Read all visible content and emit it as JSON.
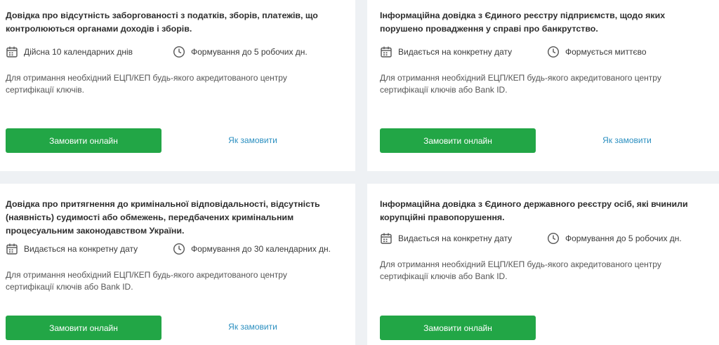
{
  "cards": [
    {
      "title": "Довідка про відсутність заборгованості з податків, зборів, платежів, що контролюються органами доходів і зборів.",
      "meta1": "Дійсна 10 календарних днів",
      "meta2": "Формування до 5 робочих дн.",
      "description": "Для отримання необхідний ЕЦП/КЕП будь-якого акредитованого центру сертифікації ключів.",
      "button": "Замовити онлайн",
      "link": "Як замовити"
    },
    {
      "title": "Інформаційна довідка з Єдиного реєстру підприємств, щодо яких порушено провадження у справі про банкрутство.",
      "meta1": "Видається на конкретну дату",
      "meta2": "Формується миттєво",
      "description": "Для отримання необхідний ЕЦП/КЕП будь-якого акредитованого центру сертифікації ключів або Bank ID.",
      "button": "Замовити онлайн",
      "link": "Як замовити"
    },
    {
      "title": "Довідка про притягнення до кримінальної відповідальності, відсутність (наявність) судимості або обмежень, передбачених кримінальним процесуальним законодавством України.",
      "meta1": "Видається на конкретну дату",
      "meta2": "Формування до 30 календарних дн.",
      "description": "Для отримання необхідний ЕЦП/КЕП будь-якого акредитованого центру сертифікації ключів або Bank ID.",
      "button": "Замовити онлайн",
      "link": "Як замовити"
    },
    {
      "title": "Інформаційна довідка з Єдиного державного реєстру осіб, які вчинили корупційні правопорушення.",
      "meta1": "Видається на конкретну дату",
      "meta2": "Формування до 5 робочих дн.",
      "description": "Для отримання необхідний ЕЦП/КЕП будь-якого акредитованого центру сертифікації ключів або Bank ID.",
      "button": "Замовити онлайн"
    }
  ],
  "colors": {
    "button": "#22a646",
    "link": "#2b8fc0",
    "background": "#eef1f4"
  },
  "icons": {
    "meta1": "calendar-icon",
    "meta2": "clock-icon"
  }
}
